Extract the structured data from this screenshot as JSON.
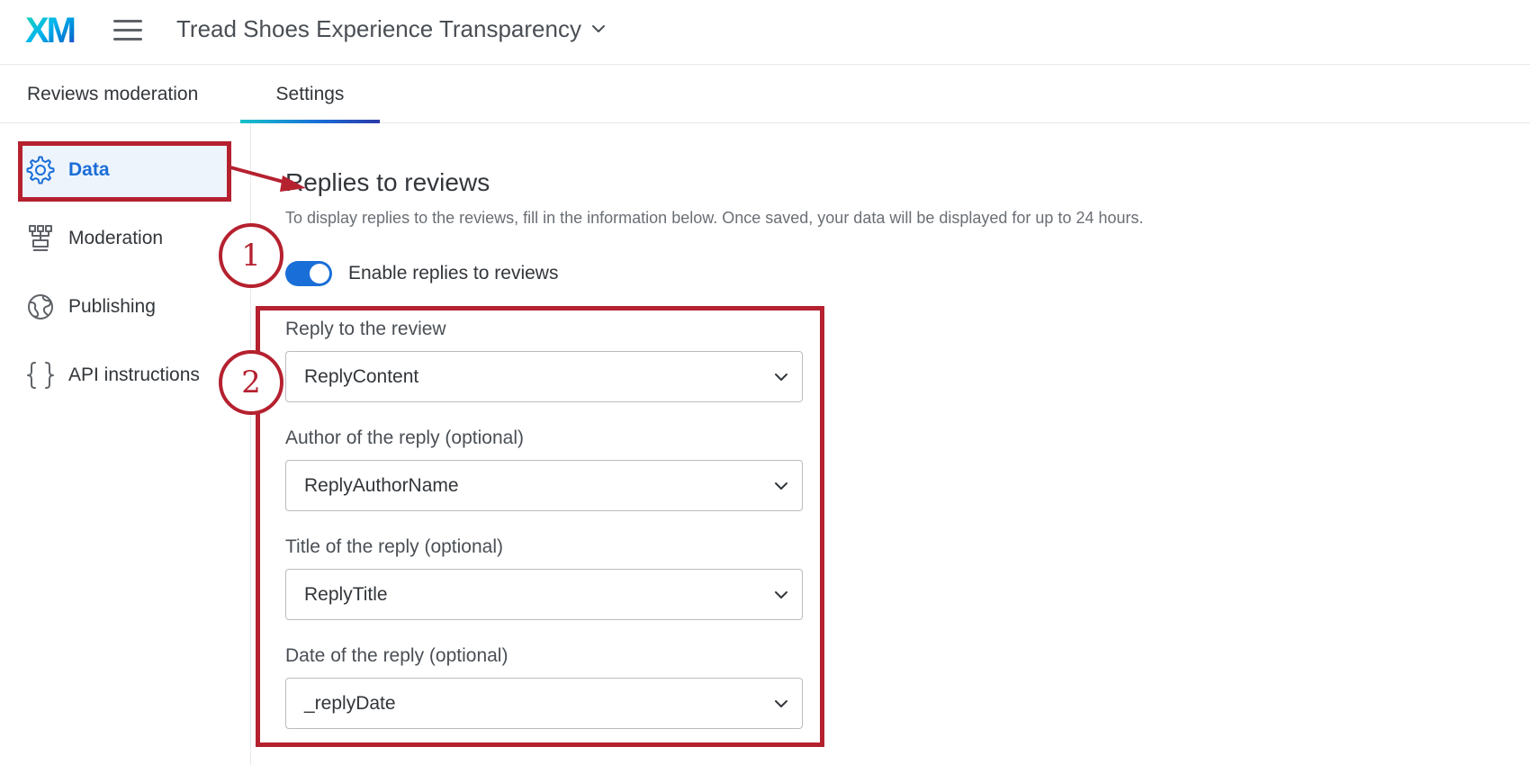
{
  "app": {
    "logo_text": "XM",
    "project_title": "Tread Shoes Experience Transparency",
    "menu_icon": "hamburger-menu-icon"
  },
  "tabs": [
    {
      "label": "Reviews moderation",
      "active": false
    },
    {
      "label": "Settings",
      "active": true
    }
  ],
  "sidebar": {
    "items": [
      {
        "label": "Data",
        "icon": "gear-icon",
        "active": true
      },
      {
        "label": "Moderation",
        "icon": "moderation-icon",
        "active": false
      },
      {
        "label": "Publishing",
        "icon": "globe-icon",
        "active": false
      },
      {
        "label": "API instructions",
        "icon": "braces-icon",
        "active": false
      }
    ]
  },
  "main": {
    "title": "Replies to reviews",
    "description": "To display replies to the reviews, fill in the information below. Once saved, your data will be displayed for up to 24 hours.",
    "toggle": {
      "label": "Enable replies to reviews",
      "enabled": true
    },
    "fields": [
      {
        "label": "Reply to the review",
        "value": "ReplyContent"
      },
      {
        "label": "Author of the reply (optional)",
        "value": "ReplyAuthorName"
      },
      {
        "label": "Title of the reply (optional)",
        "value": "ReplyTitle"
      },
      {
        "label": "Date of the reply (optional)",
        "value": "_replyDate"
      }
    ]
  },
  "annotations": {
    "step1": "1",
    "step2": "2",
    "color": "#b5212f"
  },
  "colors": {
    "accent": "#1a6ed8",
    "annotation": "#b5212f",
    "active_bg": "#eef4fc"
  }
}
